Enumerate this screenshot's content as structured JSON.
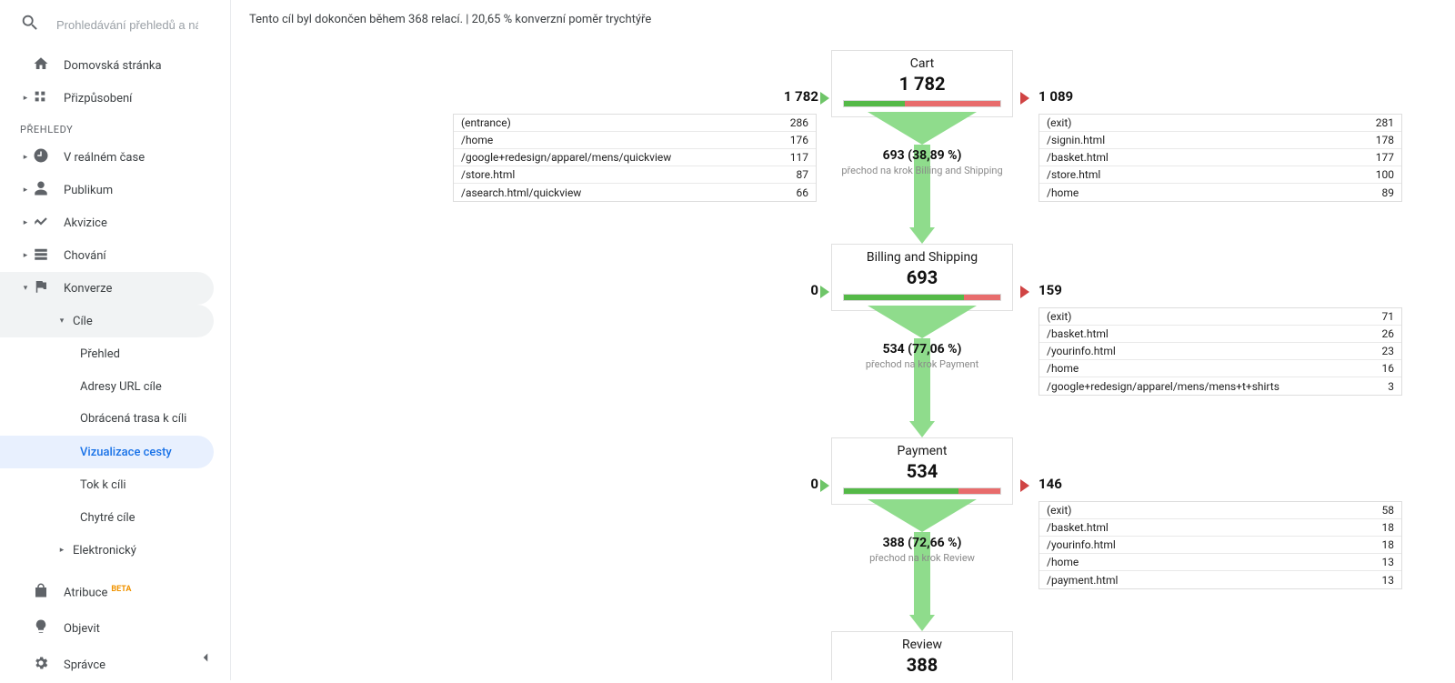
{
  "search": {
    "placeholder": "Prohledávání přehledů a náp"
  },
  "nav": {
    "home": "Domovská stránka",
    "customize": "Přizpůsobení",
    "section_reports": "PŘEHLEDY",
    "realtime": "V reálném čase",
    "audience": "Publikum",
    "acquisition": "Akvizice",
    "behavior": "Chování",
    "conversions": "Konverze",
    "goals": "Cíle",
    "goals_overview": "Přehled",
    "goals_urls": "Adresy URL cíle",
    "goals_reverse": "Obrácená trasa k cíli",
    "goals_funnelviz": "Vizualizace cesty",
    "goals_flow": "Tok k cíli",
    "goals_smart": "Chytré cíle",
    "ecommerce": "Elektronický",
    "attribution": "Atribuce",
    "beta": "BETA",
    "discover": "Objevit",
    "admin": "Správce"
  },
  "summary": "Tento cíl byl dokončen během 368 relací. | 20,65 % konverzní poměr trychtýře",
  "steps": [
    {
      "title": "Cart",
      "value": "1 782",
      "in": "1 782",
      "out": "1 089",
      "green_pct": 39,
      "sources": [
        {
          "path": "(entrance)",
          "val": "286"
        },
        {
          "path": "/home",
          "val": "176"
        },
        {
          "path": "/google+redesign/apparel/mens/quickview",
          "val": "117"
        },
        {
          "path": "/store.html",
          "val": "87"
        },
        {
          "path": "/asearch.html/quickview",
          "val": "66"
        }
      ],
      "exits": [
        {
          "path": "(exit)",
          "val": "281"
        },
        {
          "path": "/signin.html",
          "val": "178"
        },
        {
          "path": "/basket.html",
          "val": "177"
        },
        {
          "path": "/store.html",
          "val": "100"
        },
        {
          "path": "/home",
          "val": "89"
        }
      ],
      "transition": {
        "main": "693 (38,89 %)",
        "sub": "přechod na krok Billing and Shipping"
      }
    },
    {
      "title": "Billing and Shipping",
      "value": "693",
      "in": "0",
      "out": "159",
      "green_pct": 77,
      "sources": [],
      "exits": [
        {
          "path": "(exit)",
          "val": "71"
        },
        {
          "path": "/basket.html",
          "val": "26"
        },
        {
          "path": "/yourinfo.html",
          "val": "23"
        },
        {
          "path": "/home",
          "val": "16"
        },
        {
          "path": "/google+redesign/apparel/mens/mens+t+shirts",
          "val": "3"
        }
      ],
      "transition": {
        "main": "534 (77,06 %)",
        "sub": "přechod na krok Payment"
      }
    },
    {
      "title": "Payment",
      "value": "534",
      "in": "0",
      "out": "146",
      "green_pct": 73,
      "sources": [],
      "exits": [
        {
          "path": "(exit)",
          "val": "58"
        },
        {
          "path": "/basket.html",
          "val": "18"
        },
        {
          "path": "/yourinfo.html",
          "val": "18"
        },
        {
          "path": "/home",
          "val": "13"
        },
        {
          "path": "/payment.html",
          "val": "13"
        }
      ],
      "transition": {
        "main": "388 (72,66 %)",
        "sub": "přechod na krok Review"
      }
    },
    {
      "title": "Review",
      "value": "388",
      "in": null,
      "out": null,
      "green_pct": null,
      "sources": [],
      "exits": [],
      "transition": null
    }
  ]
}
